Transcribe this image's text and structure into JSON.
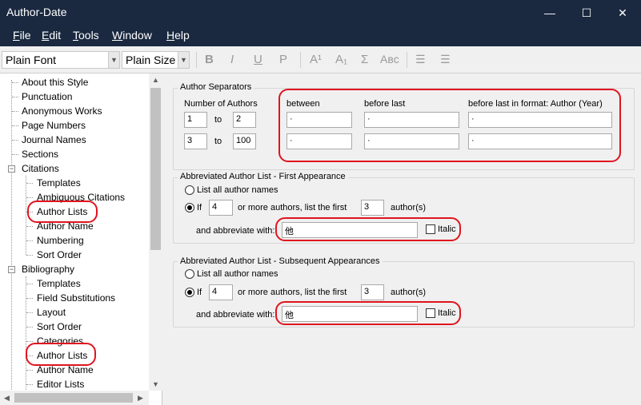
{
  "window": {
    "title": "Author-Date",
    "controls": {
      "minimize": "—",
      "maximize": "☐",
      "close": "✕"
    }
  },
  "menu": [
    {
      "key": "F",
      "rest": "ile"
    },
    {
      "key": "E",
      "rest": "dit"
    },
    {
      "key": "T",
      "rest": "ools"
    },
    {
      "key": "W",
      "rest": "indow"
    },
    {
      "key": "H",
      "rest": "elp"
    }
  ],
  "toolbar": {
    "font": "Plain Font",
    "size": "Plain Size",
    "bold": "B",
    "italic": "I",
    "underline": "U",
    "plain": "P",
    "superscript": "A¹",
    "subscript": "A₁",
    "sigma": "Σ",
    "smallcaps": "Aʙᴄ"
  },
  "tree": {
    "items": [
      "About this Style",
      "Punctuation",
      "Anonymous Works",
      "Page Numbers",
      "Journal Names",
      "Sections",
      "Citations",
      "Templates",
      "Ambiguous Citations",
      "Author Lists",
      "Author Name",
      "Numbering",
      "Sort Order",
      "Bibliography",
      "Templates",
      "Field Substitutions",
      "Layout",
      "Sort Order",
      "Categories",
      "Author Lists",
      "Author Name",
      "Editor Lists"
    ],
    "expand_minus": "−"
  },
  "separators": {
    "title": "Author Separators",
    "num_authors_label": "Number of Authors",
    "col_between": "between",
    "col_before_last": "before last",
    "col_before_last_format": "before last in format: Author (Year)",
    "to": "to",
    "rows": [
      {
        "from": "1",
        "to": "2",
        "between": "·",
        "before_last": "·",
        "format": "·"
      },
      {
        "from": "3",
        "to": "100",
        "between": "·",
        "before_last": "·",
        "format": "·"
      }
    ]
  },
  "first": {
    "title": "Abbreviated Author List - First Appearance",
    "list_all": "List all author names",
    "if_label": "If",
    "count": "4",
    "or_more": "or more authors, list the first",
    "first_n": "3",
    "authors_suffix": "author(s)",
    "abbrev_label": "and abbreviate with:",
    "abbrev_value": "他",
    "italic": "Italic"
  },
  "subsequent": {
    "title": "Abbreviated Author List - Subsequent Appearances",
    "list_all": "List all author names",
    "if_label": "If",
    "count": "4",
    "or_more": "or more authors, list the first",
    "first_n": "3",
    "authors_suffix": "author(s)",
    "abbrev_label": "and abbreviate with:",
    "abbrev_value": "他",
    "italic": "Italic"
  },
  "colors": {
    "titlebar": "#1a2940",
    "highlight": "#e0141e"
  }
}
